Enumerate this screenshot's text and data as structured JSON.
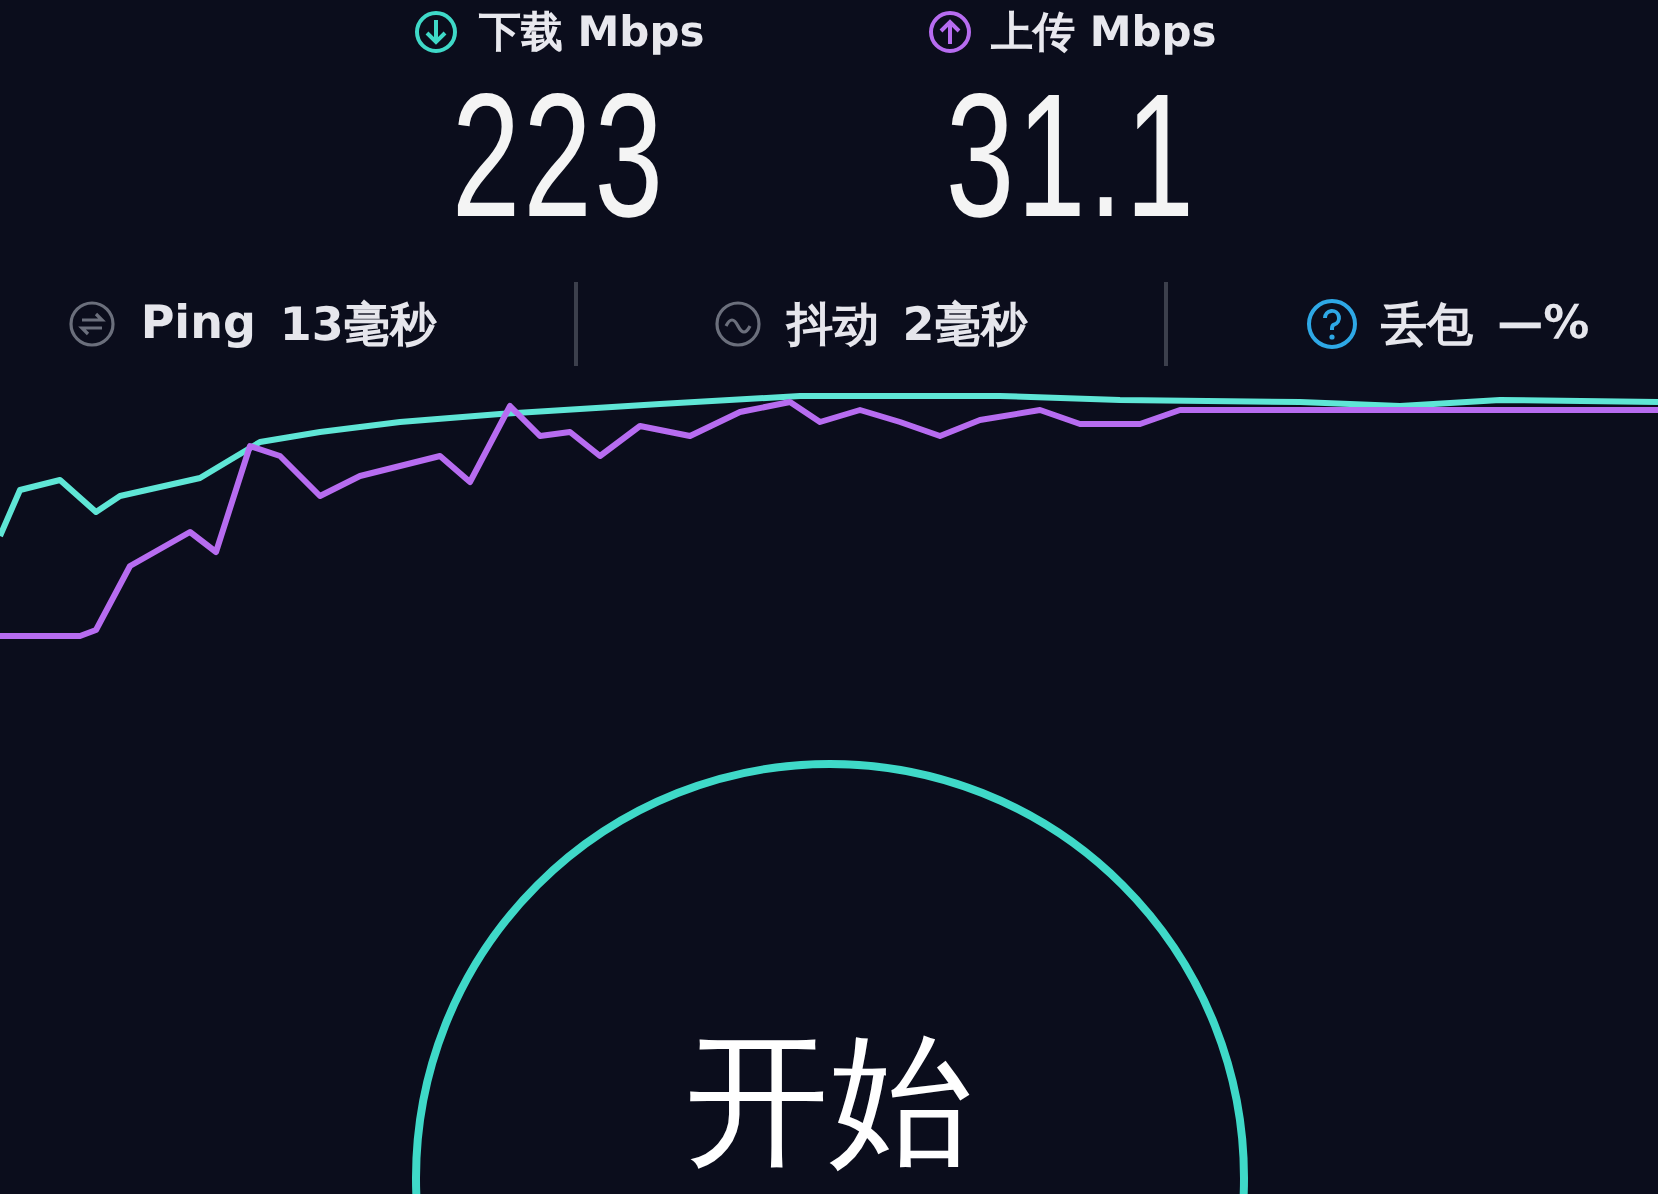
{
  "download": {
    "label": "下载 Mbps",
    "value": "223"
  },
  "upload": {
    "label": "上传 Mbps",
    "value": "31.1"
  },
  "stats": [
    {
      "kind": "ping",
      "label": "Ping",
      "value": "13毫秒"
    },
    {
      "kind": "jitter",
      "label": "抖动",
      "value": "2毫秒"
    },
    {
      "kind": "loss",
      "label": "丢包",
      "value": "—%"
    }
  ],
  "start_button": {
    "label": "开始"
  }
}
